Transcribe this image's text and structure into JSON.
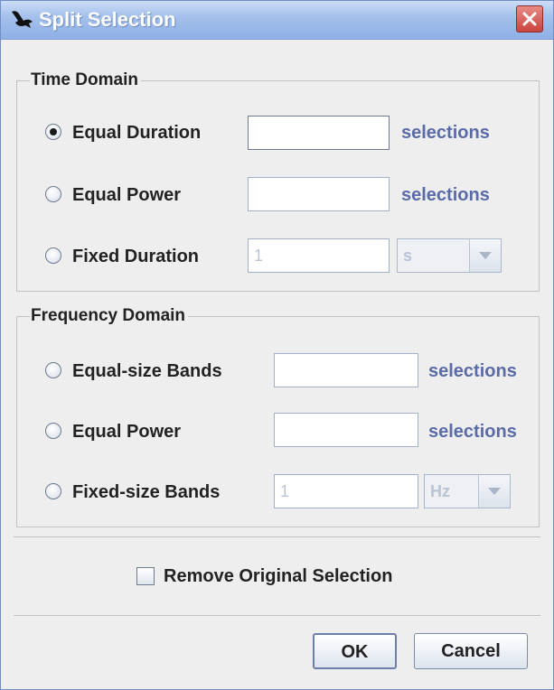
{
  "window": {
    "title": "Split Selection",
    "icons": {
      "app": "bird-logo-icon",
      "close": "close-icon"
    }
  },
  "time_domain": {
    "title": "Time Domain",
    "equal_duration": {
      "label": "Equal Duration",
      "value": "",
      "unit": "selections",
      "selected": true
    },
    "equal_power": {
      "label": "Equal Power",
      "value": "",
      "unit": "selections",
      "selected": false
    },
    "fixed_duration": {
      "label": "Fixed Duration",
      "value": "1",
      "unit_option": "s",
      "selected": false
    }
  },
  "frequency_domain": {
    "title": "Frequency Domain",
    "equal_size_bands": {
      "label": "Equal-size Bands",
      "value": "",
      "unit": "selections",
      "selected": false
    },
    "equal_power": {
      "label": "Equal Power",
      "value": "",
      "unit": "selections",
      "selected": false
    },
    "fixed_size_bands": {
      "label": "Fixed-size Bands",
      "value": "1",
      "unit_option": "Hz",
      "selected": false
    }
  },
  "options": {
    "remove_original": {
      "label": "Remove Original Selection",
      "checked": false
    }
  },
  "buttons": {
    "ok": "OK",
    "cancel": "Cancel"
  },
  "colors": {
    "title_bar": "#a5c1ec",
    "unit_text": "#5a6ba8",
    "close_button": "#c8453e"
  }
}
